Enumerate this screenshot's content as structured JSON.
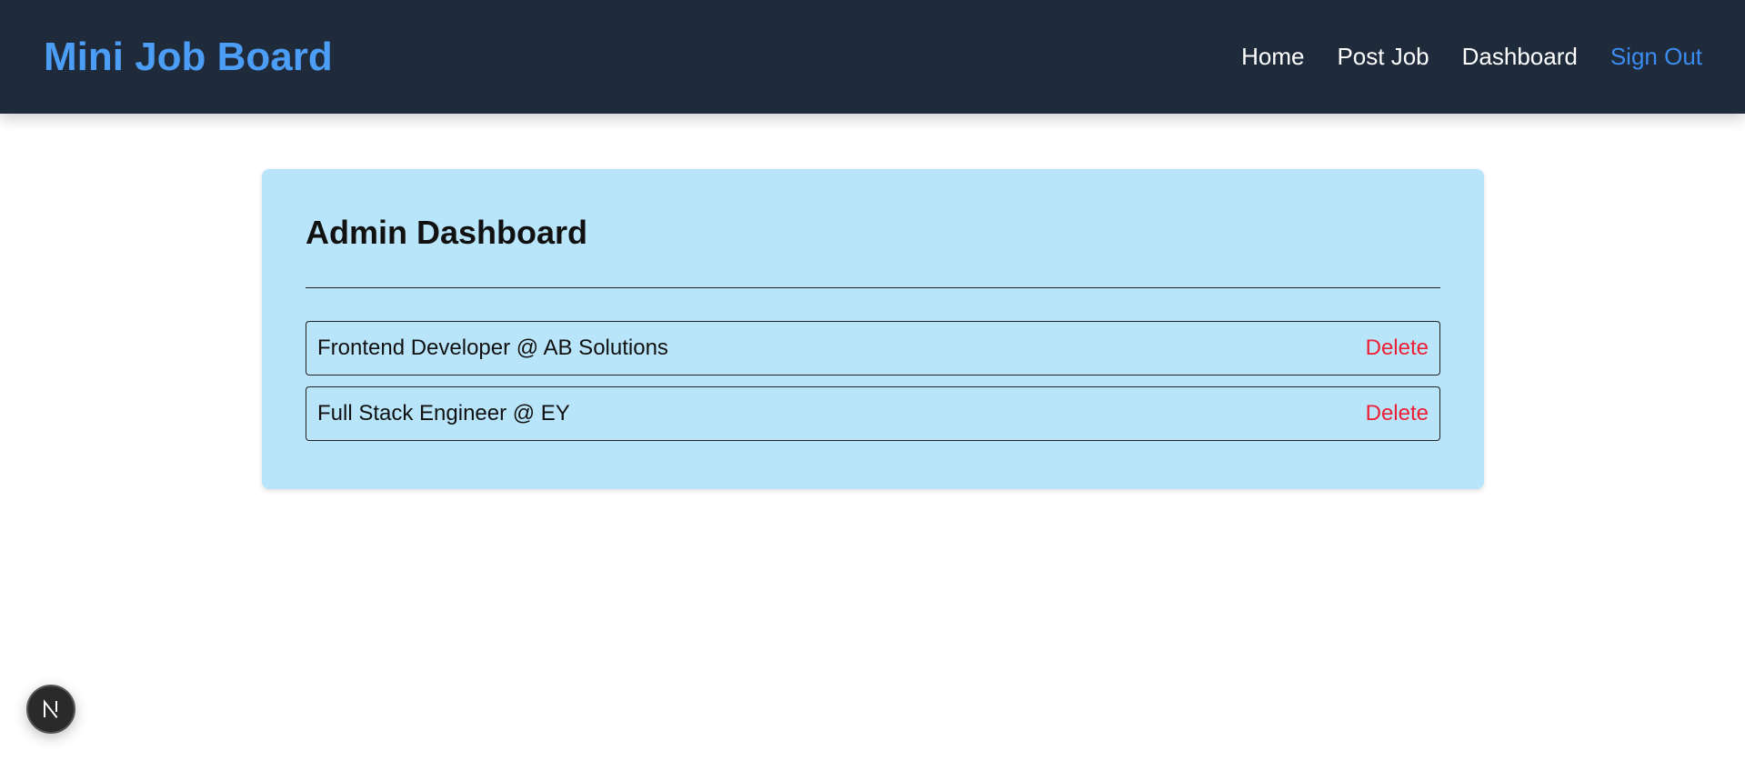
{
  "header": {
    "brand": "Mini Job Board",
    "nav": [
      {
        "label": "Home"
      },
      {
        "label": "Post Job"
      },
      {
        "label": "Dashboard"
      },
      {
        "label": "Sign Out"
      }
    ]
  },
  "dashboard": {
    "title": "Admin Dashboard",
    "jobs": [
      {
        "label": "Frontend Developer @ AB Solutions",
        "action": "Delete"
      },
      {
        "label": "Full Stack Engineer @ EY",
        "action": "Delete"
      }
    ]
  },
  "dev_badge": {
    "icon": "nextjs-logo-icon"
  },
  "colors": {
    "navbar_bg": "#1f2a3b",
    "brand": "#4c9df6",
    "sign_out": "#3b8cf0",
    "card_bg": "#b9e5fb",
    "delete": "#ef1f33"
  }
}
